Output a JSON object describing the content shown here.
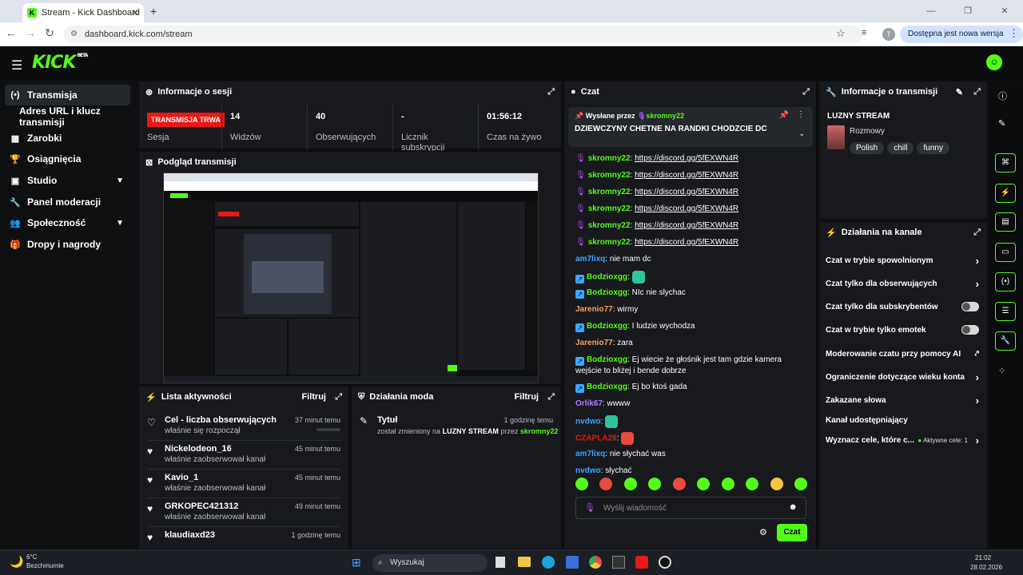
{
  "browser": {
    "tab_title": "Stream - Kick Dashboard",
    "url": "dashboard.kick.com/stream",
    "profile_initial": "T",
    "update_label": "Dostępna jest nowa wersja Chrome"
  },
  "app": {
    "logo": "KICK",
    "logo_beta": "BETA"
  },
  "sidebar": {
    "items": [
      {
        "label": "Transmisja",
        "icon": "(•)"
      },
      {
        "label": "Adres URL i klucz transmisji",
        "icon": ""
      },
      {
        "label": "Zarobki",
        "icon": "▦"
      },
      {
        "label": "Osiągnięcia",
        "icon": "🏆"
      },
      {
        "label": "Studio",
        "icon": "▣"
      },
      {
        "label": "Panel moderacji",
        "icon": "🔧"
      },
      {
        "label": "Społeczność",
        "icon": "👥"
      },
      {
        "label": "Dropy i nagrody",
        "icon": "🎁"
      }
    ]
  },
  "session": {
    "title": "Informacje o sesji",
    "live_badge": "TRANSMISJA TRWA",
    "session_label": "Sesja",
    "stats": [
      {
        "value": "14",
        "label": "Widzów"
      },
      {
        "value": "40",
        "label": "Obserwujących"
      },
      {
        "value": "-",
        "label": "Licznik subskrypcji"
      },
      {
        "value": "01:56:12",
        "label": "Czas na żywo"
      }
    ]
  },
  "preview": {
    "title": "Podgląd transmisji"
  },
  "activity": {
    "title": "Lista aktywności",
    "filter": "Filtruj",
    "items": [
      {
        "name": "Cel - liczba obserwujących",
        "sub": "właśnie się rozpoczął",
        "time": "37 minut temu"
      },
      {
        "name": "Nickelodeon_16",
        "sub": "właśnie zaobserwował kanał",
        "time": "45 minut temu"
      },
      {
        "name": "Kavio_1",
        "sub": "właśnie zaobserwował kanał",
        "time": "45 minut temu"
      },
      {
        "name": "GRKOPEC421312",
        "sub": "właśnie zaobserwował kanał",
        "time": "49 minut temu"
      },
      {
        "name": "klaudiaxd23",
        "sub": "właśnie zaobserwował kanał",
        "time": "1 godzinę temu"
      }
    ]
  },
  "modactions": {
    "title": "Działania moda",
    "filter": "Filtruj",
    "item": {
      "title": "Tytuł",
      "p1": "został zmieniony na ",
      "bold": "LUZNY STREAM",
      "p2": " przez ",
      "user": "skromny22",
      "time": "1 godzinę temu"
    }
  },
  "chat": {
    "title": "Czat",
    "pinned_by_label": "Wysłane przez",
    "pinned_by": "skromny22",
    "pinned_text": "DZIEWCZYNY CHETNE NA RANDKI CHODZCIE DC",
    "messages": [
      {
        "user": "skromny22",
        "color": "#53fc18",
        "badge": "mic",
        "text": "https://discord.gg/5fEXWN4R",
        "link": true
      },
      {
        "user": "skromny22",
        "color": "#53fc18",
        "badge": "mic",
        "text": "https://discord.gg/5fEXWN4R",
        "link": true
      },
      {
        "user": "skromny22",
        "color": "#53fc18",
        "badge": "mic",
        "text": "https://discord.gg/5fEXWN4R",
        "link": true
      },
      {
        "user": "skromny22",
        "color": "#53fc18",
        "badge": "mic",
        "text": "https://discord.gg/5fEXWN4R",
        "link": true
      },
      {
        "user": "skromny22",
        "color": "#53fc18",
        "badge": "mic",
        "text": "https://discord.gg/5fEXWN4R",
        "link": true
      },
      {
        "user": "skromny22",
        "color": "#53fc18",
        "badge": "mic",
        "text": "https://discord.gg/5fEXWN4R",
        "link": true
      },
      {
        "user": "am7lixq",
        "color": "#3ea6ff",
        "badge": "",
        "text": "nie mam dc"
      },
      {
        "user": "Bodzioxgg",
        "color": "#53fc18",
        "badge": "sub",
        "text": "",
        "emote": "#2ec4a0"
      },
      {
        "user": "Bodzioxgg",
        "color": "#53fc18",
        "badge": "sub",
        "text": "NIc nie slychac"
      },
      {
        "user": "Jarenio77",
        "color": "#f4a261",
        "badge": "",
        "text": "wirmy"
      },
      {
        "user": "Bodzioxgg",
        "color": "#53fc18",
        "badge": "sub",
        "text": "I ludzie wychodza"
      },
      {
        "user": "Jarenio77",
        "color": "#f4a261",
        "badge": "",
        "text": "zara"
      },
      {
        "user": "Bodzioxgg",
        "color": "#53fc18",
        "badge": "sub",
        "text": "Ej wiecie że głośnik jest tam gdzie kamera wejście to bliżej i bende dobrze"
      },
      {
        "user": "Bodzioxgg",
        "color": "#53fc18",
        "badge": "sub",
        "text": "Ej bo ktoś gada"
      },
      {
        "user": "Orlik67",
        "color": "#b07cff",
        "badge": "",
        "text": "wwww"
      },
      {
        "user": "nvdwo",
        "color": "#3ea6ff",
        "badge": "",
        "text": "",
        "emote": "#2ec4a0"
      },
      {
        "user": "CZAPLA26",
        "color": "#e91916",
        "badge": "",
        "text": "",
        "emote": "#e94b3c"
      },
      {
        "user": "am7lixq",
        "color": "#3ea6ff",
        "badge": "",
        "text": "nie słychać was"
      },
      {
        "user": "nvdwo",
        "color": "#3ea6ff",
        "badge": "",
        "text": "słychać"
      }
    ],
    "emotes": [
      "#53fc18",
      "#e94b3c",
      "#53fc18",
      "#53fc18",
      "#e94b3c",
      "#53fc18",
      "#53fc18",
      "#53fc18",
      "#f4c542",
      "#53fc18"
    ],
    "input_placeholder": "Wyślij wiadomość",
    "send": "Czat"
  },
  "streaminfo": {
    "title": "Informacje o transmisji",
    "stream_title": "LUZNY STREAM",
    "category": "Rozmowy",
    "tags": [
      "Polish",
      "chill",
      "funny"
    ]
  },
  "channel_actions": {
    "title": "Działania na kanale",
    "items": [
      {
        "label": "Czat w trybie spowolnionym",
        "ctrl": "chev"
      },
      {
        "label": "Czat tylko dla obserwujących",
        "ctrl": "chev"
      },
      {
        "label": "Czat tylko dla subskrybentów",
        "ctrl": "toggle"
      },
      {
        "label": "Czat w trybie tylko emotek",
        "ctrl": "toggle"
      },
      {
        "label": "Moderowanie czatu przy pomocy AI",
        "ctrl": "ext"
      },
      {
        "label": "Ograniczenie dotyczące wieku konta",
        "ctrl": "chev"
      },
      {
        "label": "Zakazane słowa",
        "ctrl": "chev"
      },
      {
        "label": "Kanał udostępniający",
        "ctrl": ""
      },
      {
        "label": "Wyznacz cele, które c...",
        "ctrl": "goal",
        "goal_text": "Aktywne cele: 1"
      }
    ]
  },
  "taskbar": {
    "temp": "6°C",
    "weather": "Bezchmurnie",
    "search": "Wyszukaj",
    "time": "21:02",
    "date": "28.02.2026"
  },
  "colors": {
    "brand": "#53fc18",
    "live": "#e91916",
    "panel": "#18191d"
  }
}
